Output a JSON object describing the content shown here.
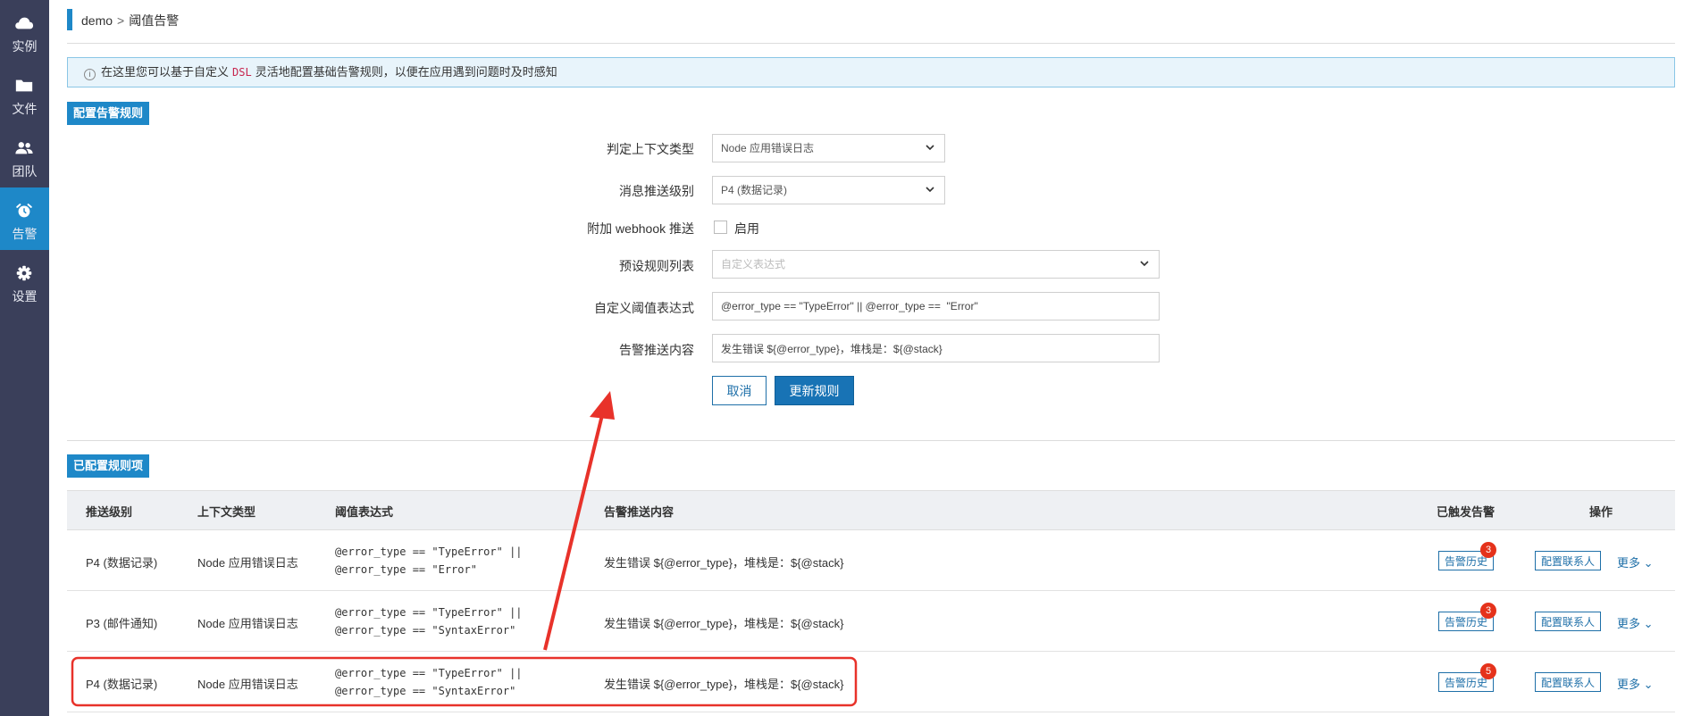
{
  "sidebar": {
    "items": [
      {
        "label": "实例",
        "icon": "cloud-icon"
      },
      {
        "label": "文件",
        "icon": "folder-icon"
      },
      {
        "label": "团队",
        "icon": "team-icon"
      },
      {
        "label": "告警",
        "icon": "alarm-clock-icon",
        "active": true
      },
      {
        "label": "设置",
        "icon": "gear-icon"
      }
    ]
  },
  "breadcrumb": {
    "root": "demo",
    "separator": ">",
    "current": "阈值告警"
  },
  "banner": {
    "text_before": "在这里您可以基于自定义",
    "code": "DSL",
    "text_after": "灵活地配置基础告警规则，以便在应用遇到问题时及时感知"
  },
  "config_section": {
    "title": "配置告警规则"
  },
  "form": {
    "context_type": {
      "label": "判定上下文类型",
      "value": "Node 应用错误日志"
    },
    "push_level": {
      "label": "消息推送级别",
      "value": "P4 (数据记录)"
    },
    "webhook": {
      "label": "附加 webhook 推送",
      "checkbox_label": "启用",
      "checked": false
    },
    "preset_rules": {
      "label": "预设规则列表",
      "placeholder": "自定义表达式"
    },
    "expression": {
      "label": "自定义阈值表达式",
      "value": "@error_type == \"TypeError\" || @error_type ==  \"Error\""
    },
    "push_content": {
      "label": "告警推送内容",
      "value": "发生错误 ${@error_type}，堆栈是：${@stack}"
    },
    "cancel_label": "取消",
    "submit_label": "更新规则"
  },
  "rules_section": {
    "title": "已配置规则项"
  },
  "table": {
    "headers": {
      "level": "推送级别",
      "context": "上下文类型",
      "expression": "阈值表达式",
      "content": "告警推送内容",
      "triggered": "已触发告警",
      "actions": "操作"
    },
    "history_label": "告警历史",
    "contacts_label": "配置联系人",
    "more_label": "更多",
    "rows": [
      {
        "level": "P4 (数据记录)",
        "context": "Node 应用错误日志",
        "expr_line1": "@error_type == \"TypeError\" ||",
        "expr_line2": "@error_type == \"Error\"",
        "content": "发生错误 ${@error_type}，堆栈是：${@stack}",
        "count": "3"
      },
      {
        "level": "P3 (邮件通知)",
        "context": "Node 应用错误日志",
        "expr_line1": "@error_type == \"TypeError\" ||",
        "expr_line2": "@error_type == \"SyntaxError\"",
        "content": "发生错误 ${@error_type}，堆栈是：${@stack}",
        "count": "3"
      },
      {
        "level": "P4 (数据记录)",
        "context": "Node 应用错误日志",
        "expr_line1": "@error_type == \"TypeError\" ||",
        "expr_line2": "@error_type == \"SyntaxError\"",
        "content": "发生错误 ${@error_type}，堆栈是：${@stack}",
        "count": "5"
      }
    ]
  },
  "colors": {
    "sidebar_bg": "#3a3f5a",
    "accent": "#1e88c8",
    "button_primary": "#1873b5",
    "badge": "#e5321b",
    "annotation": "#e8322a"
  }
}
